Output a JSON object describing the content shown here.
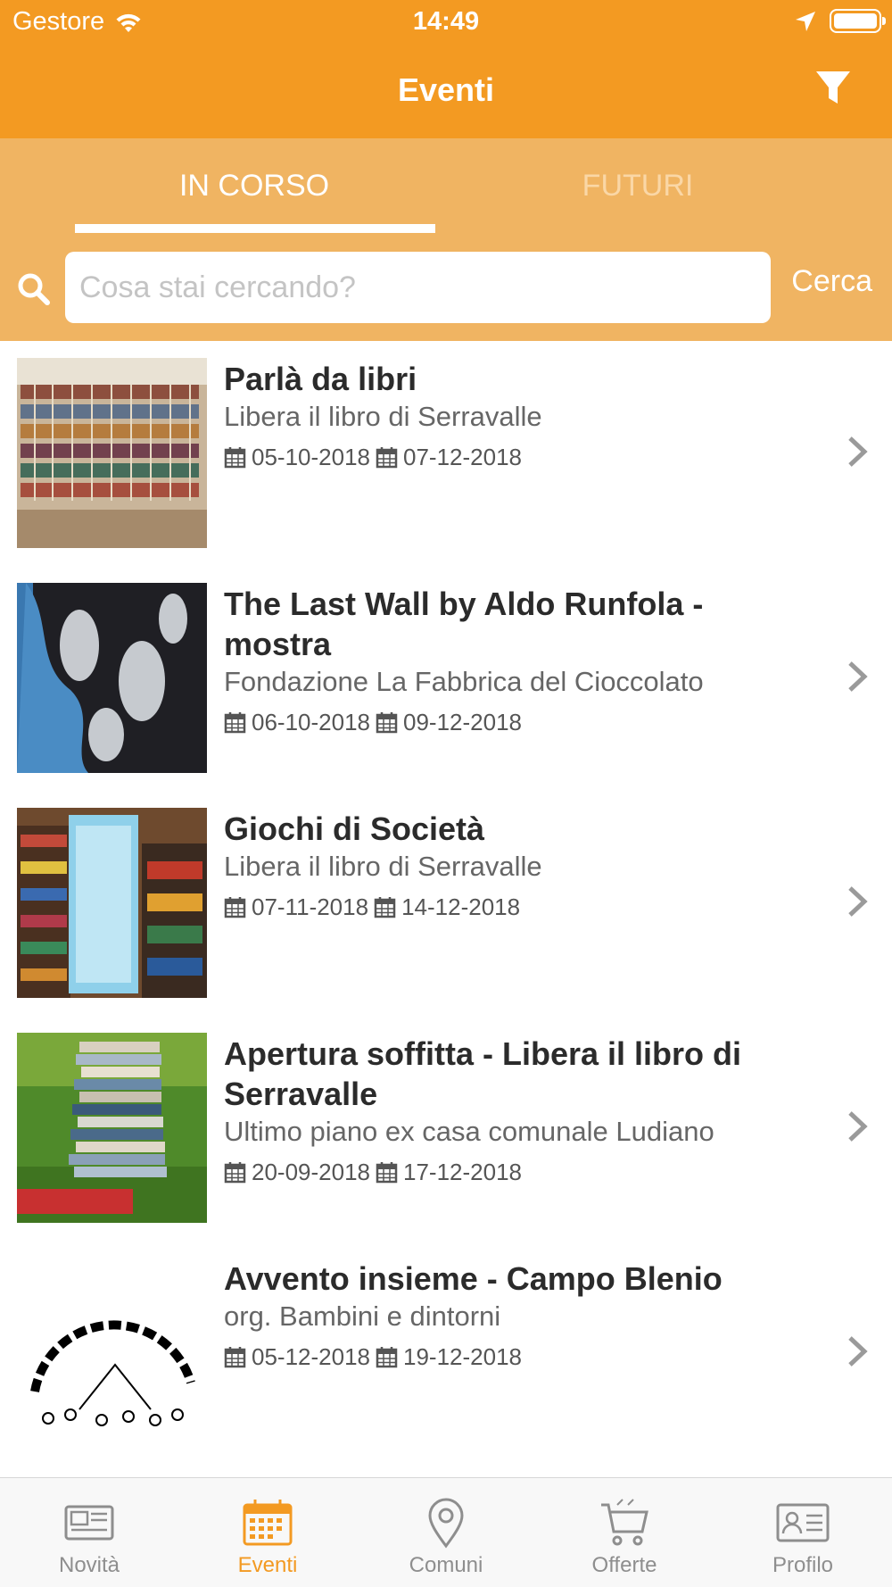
{
  "status_bar": {
    "carrier": "Gestore",
    "time": "14:49"
  },
  "nav": {
    "title": "Eventi",
    "filter_icon": "filter-icon"
  },
  "tabs": [
    {
      "label": "IN CORSO",
      "active": true
    },
    {
      "label": "FUTURI",
      "active": false
    }
  ],
  "search": {
    "placeholder": "Cosa stai cercando?",
    "value": "",
    "button_label": "Cerca"
  },
  "events": [
    {
      "title": "Parlà da libri",
      "venue": "Libera il libro di Serravalle",
      "start": "05-10-2018",
      "end": "07-12-2018"
    },
    {
      "title": "The Last Wall by Aldo Runfola - mostra",
      "venue": "Fondazione La Fabbrica del Cioccolato",
      "start": "06-10-2018",
      "end": "09-12-2018"
    },
    {
      "title": "Giochi di Società",
      "venue": "Libera il libro di Serravalle",
      "start": "07-11-2018",
      "end": "14-12-2018"
    },
    {
      "title": "Apertura soffitta - Libera il libro di Serravalle",
      "venue": "Ultimo piano ex casa comunale Ludiano",
      "start": "20-09-2018",
      "end": "17-12-2018"
    },
    {
      "title": "Avvento insieme - Campo Blenio",
      "venue": "org. Bambini e dintorni",
      "start": "05-12-2018",
      "end": "19-12-2018"
    }
  ],
  "bottom_tabs": [
    {
      "label": "Novità",
      "icon": "newspaper-icon",
      "active": false
    },
    {
      "label": "Eventi",
      "icon": "calendar-icon",
      "active": true
    },
    {
      "label": "Comuni",
      "icon": "map-pin-icon",
      "active": false
    },
    {
      "label": "Offerte",
      "icon": "cart-icon",
      "active": false
    },
    {
      "label": "Profilo",
      "icon": "id-card-icon",
      "active": false
    }
  ],
  "colors": {
    "accent": "#F39A22",
    "tabs_bg": "#F0B462",
    "inactive": "#8e8e8e"
  }
}
